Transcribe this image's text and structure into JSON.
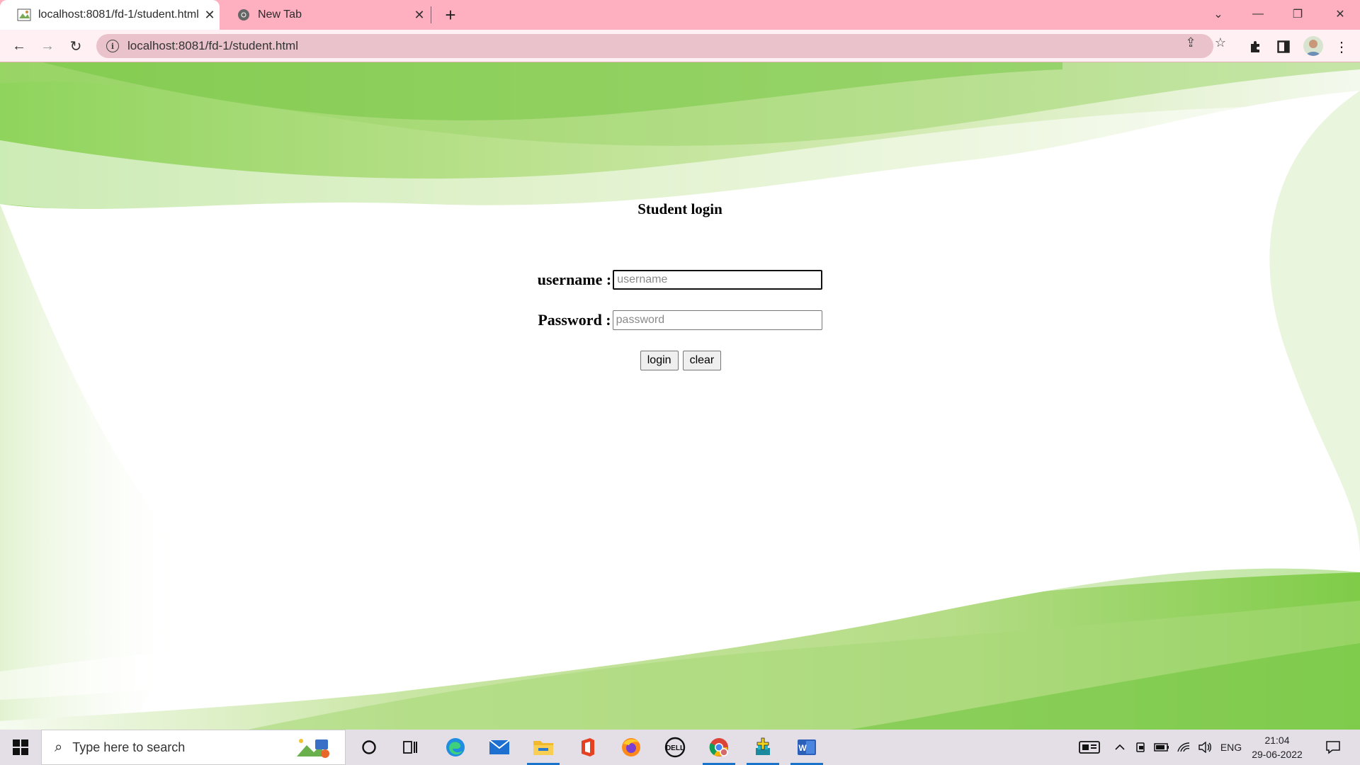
{
  "browser": {
    "tabs": [
      {
        "label": "localhost:8081/fd-1/student.html",
        "active": true
      },
      {
        "label": "New Tab",
        "active": false
      }
    ],
    "new_tab_label": "+",
    "url": "localhost:8081/fd-1/student.html"
  },
  "page": {
    "title": "Student login",
    "username_label": "username :",
    "username_placeholder": "username",
    "password_label": "Password :",
    "password_placeholder": "password",
    "login_button": "login",
    "clear_button": "clear"
  },
  "taskbar": {
    "search_placeholder": "Type here to search",
    "language": "ENG",
    "time": "21:04",
    "date": "29-06-2022"
  }
}
